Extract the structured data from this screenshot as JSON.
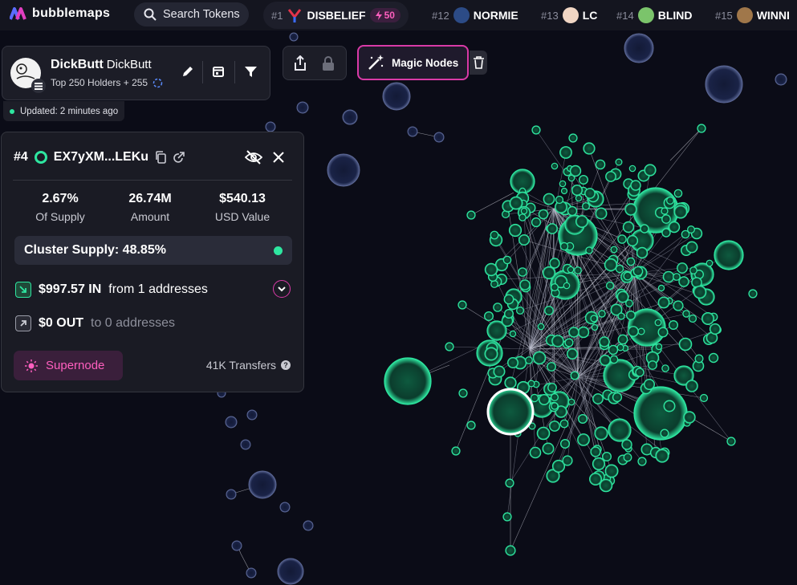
{
  "brand": {
    "name": "bubblemaps"
  },
  "search": {
    "label": "Search Tokens"
  },
  "trending": [
    {
      "rank": "#1",
      "name": "DISBELIEF",
      "boost": "50"
    },
    {
      "rank": "#12",
      "name": "NORMIE"
    },
    {
      "rank": "#13",
      "name": "LC"
    },
    {
      "rank": "#14",
      "name": "BLIND"
    },
    {
      "rank": "#15",
      "name": "WINNI"
    }
  ],
  "token": {
    "name": "DickButt",
    "symbol": "DickButt",
    "subtitle": "Top 250 Holders + 255",
    "updated": "Updated: 2 minutes ago"
  },
  "toolbar": {
    "magic_label": "Magic Nodes"
  },
  "detail": {
    "rank": "#4",
    "address": "EX7yXM...LEKu",
    "stats": [
      {
        "value": "2.67%",
        "label": "Of Supply"
      },
      {
        "value": "26.74M",
        "label": "Amount"
      },
      {
        "value": "$540.13",
        "label": "USD Value"
      }
    ],
    "cluster_supply": "Cluster Supply: 48.85%",
    "in_amount": "$997.57 IN",
    "in_from": "from 1 addresses",
    "out_amount": "$0 OUT",
    "out_to": "to 0 addresses",
    "supernode_label": "Supernode",
    "transfers": "41K Transfers"
  },
  "colors": {
    "background": "#0b0c17",
    "accent_pink": "#d93aa7",
    "node_green": "#2ee6a0",
    "node_blue": "#1e2a55"
  }
}
